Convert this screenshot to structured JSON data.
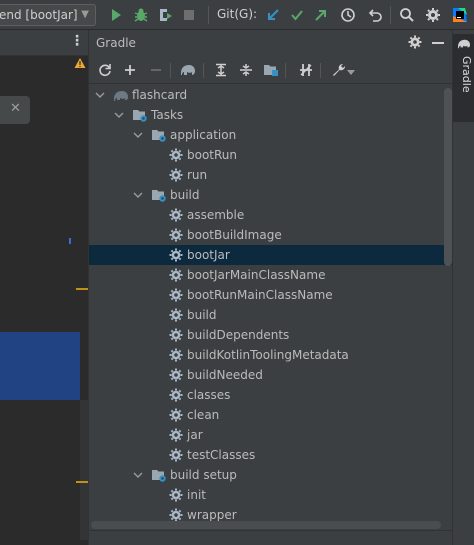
{
  "top_toolbar": {
    "run_config_label": "end [bootJar]",
    "git_label": "Git(G):"
  },
  "gradle_panel": {
    "title": "Gradle",
    "tree": [
      {
        "label": "flashcard",
        "level": 0,
        "kind": "project",
        "expanded": true
      },
      {
        "label": "Tasks",
        "level": 1,
        "kind": "folder",
        "expanded": true
      },
      {
        "label": "application",
        "level": 2,
        "kind": "folder",
        "expanded": true
      },
      {
        "label": "bootRun",
        "level": 3,
        "kind": "task"
      },
      {
        "label": "run",
        "level": 3,
        "kind": "task"
      },
      {
        "label": "build",
        "level": 2,
        "kind": "folder",
        "expanded": true
      },
      {
        "label": "assemble",
        "level": 3,
        "kind": "task"
      },
      {
        "label": "bootBuildImage",
        "level": 3,
        "kind": "task"
      },
      {
        "label": "bootJar",
        "level": 3,
        "kind": "task",
        "selected": true
      },
      {
        "label": "bootJarMainClassName",
        "level": 3,
        "kind": "task"
      },
      {
        "label": "bootRunMainClassName",
        "level": 3,
        "kind": "task"
      },
      {
        "label": "build",
        "level": 3,
        "kind": "task"
      },
      {
        "label": "buildDependents",
        "level": 3,
        "kind": "task"
      },
      {
        "label": "buildKotlinToolingMetadata",
        "level": 3,
        "kind": "task"
      },
      {
        "label": "buildNeeded",
        "level": 3,
        "kind": "task"
      },
      {
        "label": "classes",
        "level": 3,
        "kind": "task"
      },
      {
        "label": "clean",
        "level": 3,
        "kind": "task"
      },
      {
        "label": "jar",
        "level": 3,
        "kind": "task"
      },
      {
        "label": "testClasses",
        "level": 3,
        "kind": "task"
      },
      {
        "label": "build setup",
        "level": 2,
        "kind": "folder",
        "expanded": true
      },
      {
        "label": "init",
        "level": 3,
        "kind": "task"
      },
      {
        "label": "wrapper",
        "level": 3,
        "kind": "task"
      }
    ]
  },
  "right_strip": {
    "tab_label": "Gradle"
  },
  "colors": {
    "background": "#3c3f41",
    "editor_bg": "#2b2b2b",
    "selection": "#0d293e",
    "run_green": "#59a869",
    "git_blue": "#3592c4",
    "warning": "#f0a732",
    "gear_gray": "#a9b7c6"
  }
}
